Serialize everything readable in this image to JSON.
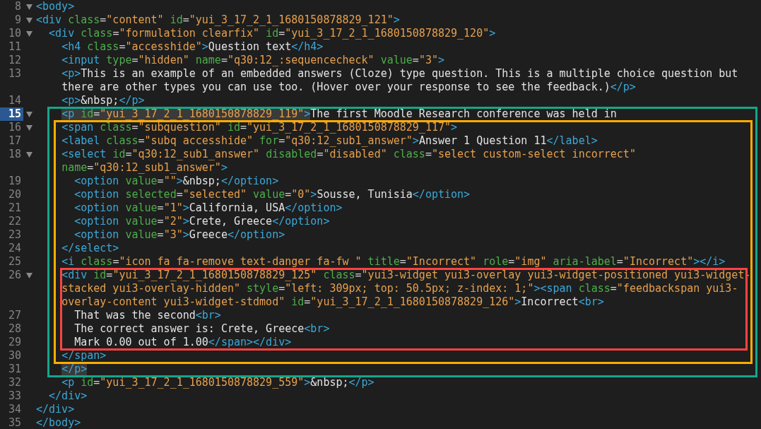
{
  "lines": [
    {
      "kind": "row",
      "number": "8",
      "fold": true,
      "current": false,
      "tokens": [
        {
          "kind": "tag",
          "text": "<body>"
        }
      ]
    },
    {
      "kind": "row",
      "number": "9",
      "fold": true,
      "current": false,
      "tokens": [
        {
          "kind": "tag",
          "text": "<div "
        },
        {
          "kind": "attr",
          "text": "class"
        },
        {
          "kind": "punct",
          "text": "="
        },
        {
          "kind": "string",
          "text": "\"content\" "
        },
        {
          "kind": "attr",
          "text": "id"
        },
        {
          "kind": "punct",
          "text": "="
        },
        {
          "kind": "string",
          "text": "\"yui_3_17_2_1_1680150878829_121\""
        },
        {
          "kind": "tag",
          "text": ">"
        }
      ]
    },
    {
      "kind": "row",
      "number": "10",
      "fold": true,
      "current": false,
      "tokens": [
        {
          "kind": "tag",
          "text": "  <div "
        },
        {
          "kind": "attr",
          "text": "class"
        },
        {
          "kind": "punct",
          "text": "="
        },
        {
          "kind": "string",
          "text": "\"formulation clearfix\" "
        },
        {
          "kind": "attr",
          "text": "id"
        },
        {
          "kind": "punct",
          "text": "="
        },
        {
          "kind": "string",
          "text": "\"yui_3_17_2_1_1680150878829_120\""
        },
        {
          "kind": "tag",
          "text": ">"
        }
      ]
    },
    {
      "kind": "row",
      "number": "11",
      "fold": false,
      "current": false,
      "tokens": [
        {
          "kind": "tag",
          "text": "    <h4 "
        },
        {
          "kind": "attr",
          "text": "class"
        },
        {
          "kind": "punct",
          "text": "="
        },
        {
          "kind": "string",
          "text": "\"accesshide\""
        },
        {
          "kind": "tag",
          "text": ">"
        },
        {
          "kind": "text",
          "text": "Question text"
        },
        {
          "kind": "tag",
          "text": "</h4>"
        }
      ]
    },
    {
      "kind": "row",
      "number": "12",
      "fold": false,
      "current": false,
      "tokens": [
        {
          "kind": "tag",
          "text": "    <input "
        },
        {
          "kind": "attr",
          "text": "type"
        },
        {
          "kind": "punct",
          "text": "="
        },
        {
          "kind": "string",
          "text": "\"hidden\" "
        },
        {
          "kind": "attr",
          "text": "name"
        },
        {
          "kind": "punct",
          "text": "="
        },
        {
          "kind": "string",
          "text": "\"q30:12_:sequencecheck\" "
        },
        {
          "kind": "attr",
          "text": "value"
        },
        {
          "kind": "punct",
          "text": "="
        },
        {
          "kind": "string",
          "text": "\"3\""
        },
        {
          "kind": "tag",
          "text": ">"
        }
      ]
    },
    {
      "kind": "row",
      "number": "13",
      "fold": false,
      "current": false,
      "tokens": [
        {
          "kind": "tag",
          "text": "    <p>"
        },
        {
          "kind": "text",
          "text": "This is an example of an embedded answers (Cloze) type question. This is a multiple choice question but"
        }
      ]
    },
    {
      "kind": "row",
      "tokens": [
        {
          "kind": "text",
          "text": "    there are other types you can use too. (Hover over your response to see the feedback.)"
        },
        {
          "kind": "tag",
          "text": "</p>"
        }
      ]
    },
    {
      "kind": "row",
      "number": "14",
      "fold": false,
      "current": false,
      "tokens": [
        {
          "kind": "tag",
          "text": "    <p>"
        },
        {
          "kind": "text",
          "text": "&nbsp;"
        },
        {
          "kind": "tag",
          "text": "</p>"
        }
      ]
    },
    {
      "kind": "frame",
      "color": "#14a68a",
      "children": [
        {
          "kind": "row",
          "number": "15",
          "fold": true,
          "current": true,
          "tokens": [
            {
              "kind": "tag",
              "text": "    <p ",
              "matched": true
            },
            {
              "kind": "attr",
              "text": "id",
              "matched": true
            },
            {
              "kind": "punct",
              "text": "=",
              "matched": true
            },
            {
              "kind": "string",
              "text": "\"yui_3_17_2_1_1680150878829_119\"",
              "matched": true
            },
            {
              "kind": "tag",
              "text": ">",
              "matched": true
            },
            {
              "kind": "text",
              "text": "The first Moodle Research conference was held in"
            }
          ]
        },
        {
          "kind": "frame",
          "color": "#ffad00",
          "children": [
            {
              "kind": "row",
              "number": "16",
              "fold": true,
              "current": false,
              "tokens": [
                {
                  "kind": "tag",
                  "text": "    <span "
                },
                {
                  "kind": "attr",
                  "text": "class"
                },
                {
                  "kind": "punct",
                  "text": "="
                },
                {
                  "kind": "string",
                  "text": "\"subquestion\" "
                },
                {
                  "kind": "attr",
                  "text": "id"
                },
                {
                  "kind": "punct",
                  "text": "="
                },
                {
                  "kind": "string",
                  "text": "\"yui_3_17_2_1_1680150878829_117\""
                },
                {
                  "kind": "tag",
                  "text": ">"
                }
              ]
            },
            {
              "kind": "row",
              "number": "17",
              "fold": false,
              "current": false,
              "tokens": [
                {
                  "kind": "tag",
                  "text": "    <label "
                },
                {
                  "kind": "attr",
                  "text": "class"
                },
                {
                  "kind": "punct",
                  "text": "="
                },
                {
                  "kind": "string",
                  "text": "\"subq accesshide\" "
                },
                {
                  "kind": "attr",
                  "text": "for"
                },
                {
                  "kind": "punct",
                  "text": "="
                },
                {
                  "kind": "string",
                  "text": "\"q30:12_sub1_answer\""
                },
                {
                  "kind": "tag",
                  "text": ">"
                },
                {
                  "kind": "text",
                  "text": "Answer 1 Question 11"
                },
                {
                  "kind": "tag",
                  "text": "</label>"
                }
              ]
            },
            {
              "kind": "row",
              "number": "18",
              "fold": true,
              "current": false,
              "tokens": [
                {
                  "kind": "tag",
                  "text": "    <select "
                },
                {
                  "kind": "attr",
                  "text": "id"
                },
                {
                  "kind": "punct",
                  "text": "="
                },
                {
                  "kind": "string",
                  "text": "\"q30:12_sub1_answer\" "
                },
                {
                  "kind": "attr",
                  "text": "disabled"
                },
                {
                  "kind": "punct",
                  "text": "="
                },
                {
                  "kind": "string",
                  "text": "\"disabled\" "
                },
                {
                  "kind": "attr",
                  "text": "class"
                },
                {
                  "kind": "punct",
                  "text": "="
                },
                {
                  "kind": "string",
                  "text": "\"select custom-select incorrect\""
                }
              ]
            },
            {
              "kind": "row",
              "tokens": [
                {
                  "kind": "attr",
                  "text": "    name"
                },
                {
                  "kind": "punct",
                  "text": "="
                },
                {
                  "kind": "string",
                  "text": "\"q30:12_sub1_answer\""
                },
                {
                  "kind": "tag",
                  "text": ">"
                }
              ]
            },
            {
              "kind": "row",
              "number": "19",
              "fold": false,
              "current": false,
              "tokens": [
                {
                  "kind": "tag",
                  "text": "      <option "
                },
                {
                  "kind": "attr",
                  "text": "value"
                },
                {
                  "kind": "punct",
                  "text": "="
                },
                {
                  "kind": "string",
                  "text": "\"\""
                },
                {
                  "kind": "tag",
                  "text": ">"
                },
                {
                  "kind": "text",
                  "text": "&nbsp;"
                },
                {
                  "kind": "tag",
                  "text": "</option>"
                }
              ]
            },
            {
              "kind": "row",
              "number": "20",
              "fold": false,
              "current": false,
              "tokens": [
                {
                  "kind": "tag",
                  "text": "      <option "
                },
                {
                  "kind": "attr",
                  "text": "selected"
                },
                {
                  "kind": "punct",
                  "text": "="
                },
                {
                  "kind": "string",
                  "text": "\"selected\" "
                },
                {
                  "kind": "attr",
                  "text": "value"
                },
                {
                  "kind": "punct",
                  "text": "="
                },
                {
                  "kind": "string",
                  "text": "\"0\""
                },
                {
                  "kind": "tag",
                  "text": ">"
                },
                {
                  "kind": "text",
                  "text": "Sousse, Tunisia"
                },
                {
                  "kind": "tag",
                  "text": "</option>"
                }
              ]
            },
            {
              "kind": "row",
              "number": "21",
              "fold": false,
              "current": false,
              "tokens": [
                {
                  "kind": "tag",
                  "text": "      <option "
                },
                {
                  "kind": "attr",
                  "text": "value"
                },
                {
                  "kind": "punct",
                  "text": "="
                },
                {
                  "kind": "string",
                  "text": "\"1\""
                },
                {
                  "kind": "tag",
                  "text": ">"
                },
                {
                  "kind": "text",
                  "text": "California, USA"
                },
                {
                  "kind": "tag",
                  "text": "</option>"
                }
              ]
            },
            {
              "kind": "row",
              "number": "22",
              "fold": false,
              "current": false,
              "tokens": [
                {
                  "kind": "tag",
                  "text": "      <option "
                },
                {
                  "kind": "attr",
                  "text": "value"
                },
                {
                  "kind": "punct",
                  "text": "="
                },
                {
                  "kind": "string",
                  "text": "\"2\""
                },
                {
                  "kind": "tag",
                  "text": ">"
                },
                {
                  "kind": "text",
                  "text": "Crete, Greece"
                },
                {
                  "kind": "tag",
                  "text": "</option>"
                }
              ]
            },
            {
              "kind": "row",
              "number": "23",
              "fold": false,
              "current": false,
              "tokens": [
                {
                  "kind": "tag",
                  "text": "      <option "
                },
                {
                  "kind": "attr",
                  "text": "value"
                },
                {
                  "kind": "punct",
                  "text": "="
                },
                {
                  "kind": "string",
                  "text": "\"3\""
                },
                {
                  "kind": "tag",
                  "text": ">"
                },
                {
                  "kind": "text",
                  "text": "Greece"
                },
                {
                  "kind": "tag",
                  "text": "</option>"
                }
              ]
            },
            {
              "kind": "row",
              "number": "24",
              "fold": false,
              "current": false,
              "tokens": [
                {
                  "kind": "tag",
                  "text": "    </select>"
                }
              ]
            },
            {
              "kind": "row",
              "number": "25",
              "fold": false,
              "current": false,
              "tokens": [
                {
                  "kind": "tag",
                  "text": "    <i "
                },
                {
                  "kind": "attr",
                  "text": "class"
                },
                {
                  "kind": "punct",
                  "text": "="
                },
                {
                  "kind": "string",
                  "text": "\"icon fa fa-remove text-danger fa-fw \" "
                },
                {
                  "kind": "attr",
                  "text": "title"
                },
                {
                  "kind": "punct",
                  "text": "="
                },
                {
                  "kind": "string",
                  "text": "\"Incorrect\" "
                },
                {
                  "kind": "attr",
                  "text": "role"
                },
                {
                  "kind": "punct",
                  "text": "="
                },
                {
                  "kind": "string",
                  "text": "\"img\" "
                },
                {
                  "kind": "attr",
                  "text": "aria-label"
                },
                {
                  "kind": "punct",
                  "text": "="
                },
                {
                  "kind": "string",
                  "text": "\"Incorrect\""
                },
                {
                  "kind": "tag",
                  "text": "></i>"
                }
              ]
            },
            {
              "kind": "frame",
              "color": "#ff4343",
              "children": [
                {
                  "kind": "row",
                  "number": "26",
                  "fold": true,
                  "current": false,
                  "tokens": [
                    {
                      "kind": "tag",
                      "text": "    <div "
                    },
                    {
                      "kind": "attr",
                      "text": "id"
                    },
                    {
                      "kind": "punct",
                      "text": "="
                    },
                    {
                      "kind": "string",
                      "text": "\"yui_3_17_2_1_1680150878829_125\" "
                    },
                    {
                      "kind": "attr",
                      "text": "class"
                    },
                    {
                      "kind": "punct",
                      "text": "="
                    },
                    {
                      "kind": "string",
                      "text": "\"yui3-widget yui3-overlay yui3-widget-positioned yui3-widget-"
                    }
                  ]
                },
                {
                  "kind": "row",
                  "tokens": [
                    {
                      "kind": "string",
                      "text": "    stacked yui3-overlay-hidden\" "
                    },
                    {
                      "kind": "attr",
                      "text": "style"
                    },
                    {
                      "kind": "punct",
                      "text": "="
                    },
                    {
                      "kind": "string",
                      "text": "\"left: 309px; top: 50.5px; z-index: 1;\""
                    },
                    {
                      "kind": "tag",
                      "text": "><span "
                    },
                    {
                      "kind": "attr",
                      "text": "class"
                    },
                    {
                      "kind": "punct",
                      "text": "="
                    },
                    {
                      "kind": "string",
                      "text": "\"feedbackspan yui3-"
                    }
                  ]
                },
                {
                  "kind": "row",
                  "tokens": [
                    {
                      "kind": "string",
                      "text": "    overlay-content yui3-widget-stdmod\" "
                    },
                    {
                      "kind": "attr",
                      "text": "id"
                    },
                    {
                      "kind": "punct",
                      "text": "="
                    },
                    {
                      "kind": "string",
                      "text": "\"yui_3_17_2_1_1680150878829_126\""
                    },
                    {
                      "kind": "tag",
                      "text": ">"
                    },
                    {
                      "kind": "text",
                      "text": "Incorrect"
                    },
                    {
                      "kind": "tag",
                      "text": "<br>"
                    }
                  ]
                },
                {
                  "kind": "row",
                  "number": "27",
                  "fold": false,
                  "current": false,
                  "tokens": [
                    {
                      "kind": "text",
                      "text": "      That was the second"
                    },
                    {
                      "kind": "tag",
                      "text": "<br>"
                    }
                  ]
                },
                {
                  "kind": "row",
                  "number": "28",
                  "fold": false,
                  "current": false,
                  "tokens": [
                    {
                      "kind": "text",
                      "text": "      The correct answer is: Crete, Greece"
                    },
                    {
                      "kind": "tag",
                      "text": "<br>"
                    }
                  ]
                },
                {
                  "kind": "row",
                  "number": "29",
                  "fold": false,
                  "current": false,
                  "tokens": [
                    {
                      "kind": "text",
                      "text": "      Mark 0.00 out of 1.00"
                    },
                    {
                      "kind": "tag",
                      "text": "</span></div>"
                    }
                  ]
                }
              ]
            },
            {
              "kind": "row",
              "number": "30",
              "fold": false,
              "current": false,
              "tokens": [
                {
                  "kind": "tag",
                  "text": "    </span>"
                }
              ]
            }
          ]
        },
        {
          "kind": "row",
          "number": "31",
          "fold": false,
          "current": false,
          "tokens": [
            {
              "kind": "tag",
              "text": "    </p>",
              "matched": true
            }
          ]
        }
      ]
    },
    {
      "kind": "row",
      "number": "32",
      "fold": false,
      "current": false,
      "tokens": [
        {
          "kind": "tag",
          "text": "    <p "
        },
        {
          "kind": "attr",
          "text": "id"
        },
        {
          "kind": "punct",
          "text": "="
        },
        {
          "kind": "string",
          "text": "\"yui_3_17_2_1_1680150878829_559\""
        },
        {
          "kind": "tag",
          "text": ">"
        },
        {
          "kind": "text",
          "text": "&nbsp;"
        },
        {
          "kind": "tag",
          "text": "</p>"
        }
      ]
    },
    {
      "kind": "row",
      "number": "33",
      "fold": false,
      "current": false,
      "tokens": [
        {
          "kind": "tag",
          "text": "  </div>"
        }
      ]
    },
    {
      "kind": "row",
      "number": "34",
      "fold": false,
      "current": false,
      "tokens": [
        {
          "kind": "tag",
          "text": "</div>"
        }
      ]
    },
    {
      "kind": "row",
      "number": "35",
      "fold": false,
      "current": false,
      "tokens": [
        {
          "kind": "tag",
          "text": "</body>"
        }
      ]
    }
  ]
}
